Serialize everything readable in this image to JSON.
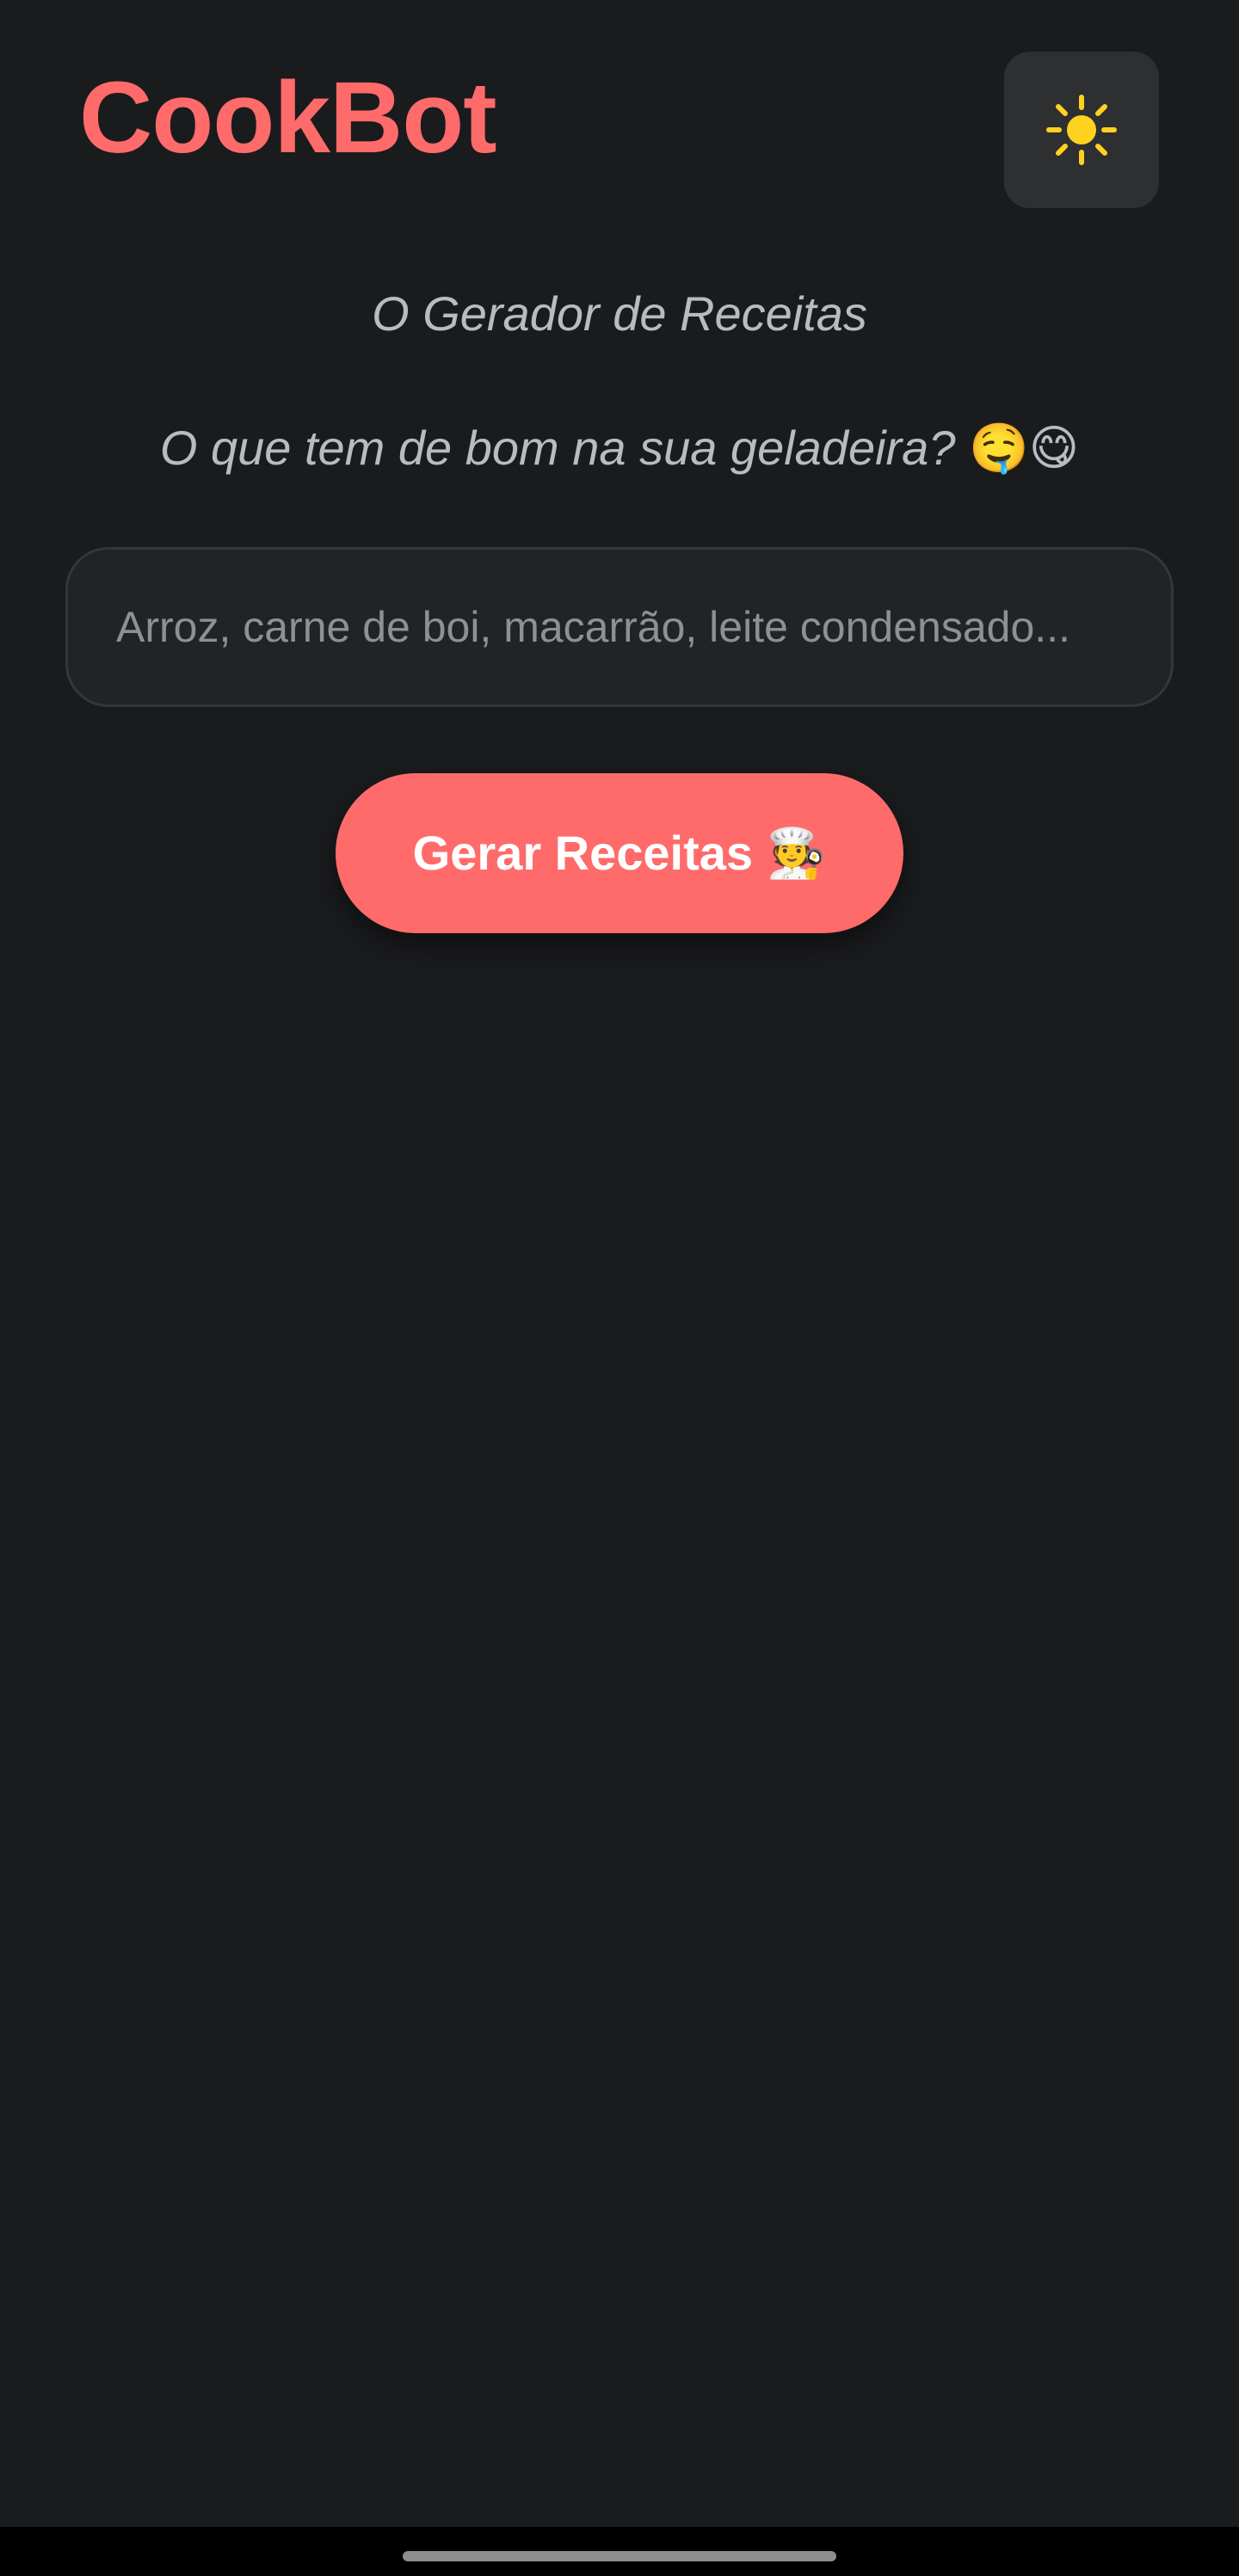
{
  "app": {
    "title": "CookBot",
    "brand_color": "#ff6b6b",
    "background_color": "#1a1b1d"
  },
  "header": {
    "theme_toggle": {
      "icon": "sun-icon",
      "icon_color": "#ffd21f"
    }
  },
  "hero": {
    "subtitle": "O Gerador de Receitas",
    "question": "O que tem de bom na sua geladeira?",
    "question_emoji": "🤤😋"
  },
  "form": {
    "ingredients_placeholder": "Arroz, carne de boi, macarrão, leite condensado...",
    "ingredients_value": "",
    "generate_label": "Gerar Receitas 🧑‍🍳"
  }
}
